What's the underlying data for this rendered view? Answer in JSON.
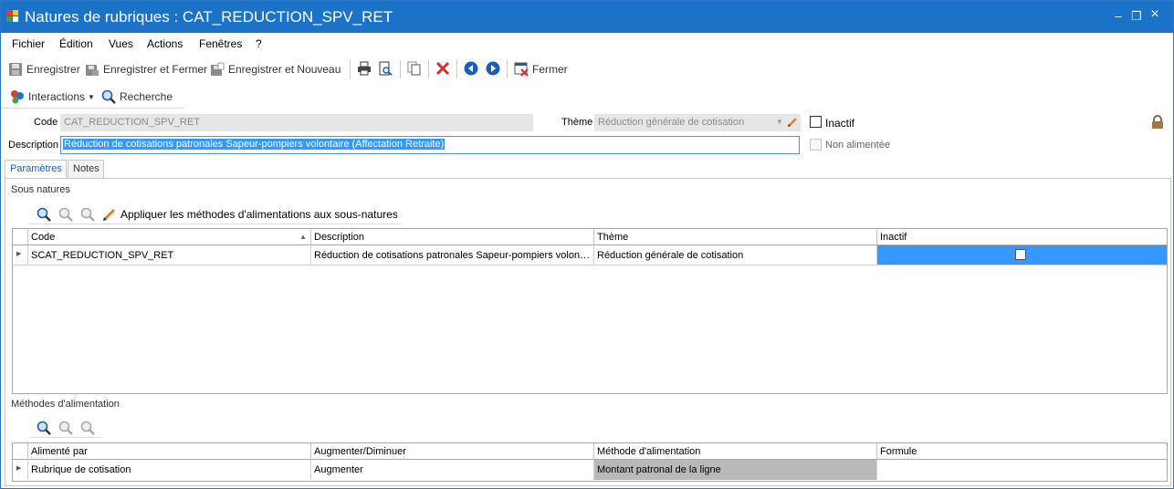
{
  "window": {
    "title": "Natures de rubriques : CAT_REDUCTION_SPV_RET",
    "minimize": "–",
    "restore": "❐",
    "close": "×"
  },
  "menu": [
    "Fichier",
    "Édition",
    "Vues",
    "Actions",
    "Fenêtres",
    "?"
  ],
  "toolbar": {
    "save": "Enregistrer",
    "save_close": "Enregistrer et Fermer",
    "save_new": "Enregistrer et Nouveau",
    "close": "Fermer"
  },
  "toolbar2": {
    "interactions": "Interactions",
    "search": "Recherche"
  },
  "form": {
    "code_label": "Code",
    "code_value": "CAT_REDUCTION_SPV_RET",
    "theme_label": "Thème",
    "theme_value": "Réduction générale de cotisation",
    "inactive_label": "Inactif",
    "inactive_checked": false,
    "description_label": "Description",
    "description_value": "Réduction de cotisations patronales Sapeur-pompiers volontaire (Affectation Retraite)",
    "not_fed_label": "Non alimentée",
    "not_fed_checked": false
  },
  "tabs": [
    "Paramètres",
    "Notes"
  ],
  "sous_natures": {
    "title": "Sous natures",
    "apply_label": "Appliquer les méthodes d'alimentations aux sous-natures",
    "columns": [
      "Code",
      "Description",
      "Thème",
      "Inactif"
    ],
    "rows": [
      {
        "code": "SCAT_REDUCTION_SPV_RET",
        "description": "Réduction de cotisations patronales Sapeur-pompiers volontaire (Affectation Retraite)",
        "theme": "Réduction générale de cotisation",
        "inactif": false
      }
    ]
  },
  "methodes": {
    "title": "Méthodes d'alimentation",
    "columns": [
      "Alimenté par",
      "Augmenter/Diminuer",
      "Méthode d'alimentation",
      "Formule"
    ],
    "rows": [
      {
        "alimente_par": "Rubrique de cotisation",
        "augmenter": "Augmenter",
        "methode": "Montant patronal de la ligne",
        "formule": ""
      }
    ]
  },
  "colors": {
    "titlebar": "#1a73c6",
    "selection": "#3399ff",
    "disabled_field": "#e6e6e6",
    "highlight_cell": "#b9b9b9"
  }
}
